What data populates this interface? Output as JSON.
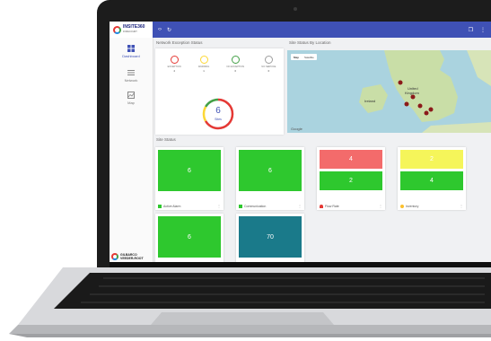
{
  "app": {
    "brand_name": "INSITE360",
    "brand_sub": "FORECOURT",
    "footer_brand_line1": "GILBARCO",
    "footer_brand_line2": "VEEDER-ROOT"
  },
  "sidebar": {
    "items": [
      {
        "label": "Dashboard",
        "icon": "dashboard-icon",
        "active": true
      },
      {
        "label": "Network",
        "icon": "list-icon",
        "active": false
      },
      {
        "label": "Map",
        "icon": "map-icon",
        "active": false
      }
    ]
  },
  "network_exception": {
    "title": "Network Exception Status",
    "items": [
      {
        "label": "EXCEPTION",
        "count": "4",
        "color": "#e53935"
      },
      {
        "label": "WARNING",
        "count": "1",
        "color": "#fdd835"
      },
      {
        "label": "NO EXCEPTION",
        "count": "0",
        "color": "#43a047"
      },
      {
        "label": "NO SERVICE",
        "count": "0",
        "color": "#9e9e9e"
      }
    ],
    "total": "6",
    "total_label": "Sites"
  },
  "location": {
    "title": "Site Status By Location",
    "tabs": [
      "Map",
      "Satellite"
    ],
    "labels": [
      "United",
      "Kingdom",
      "Ireland"
    ],
    "attribution": "Google"
  },
  "site_status": {
    "title": "Site Status",
    "cards": [
      {
        "label": "Active Alarm",
        "tiles": [
          {
            "value": "6",
            "color": "#2ec82e"
          }
        ],
        "icon_color": "#2ec82e"
      },
      {
        "label": "Communication",
        "tiles": [
          {
            "value": "6",
            "color": "#2ec82e"
          }
        ],
        "icon_color": "#2ec82e"
      },
      {
        "label": "Flow Rate",
        "tiles": [
          {
            "value": "4",
            "color": "#f36b6b"
          },
          {
            "value": "2",
            "color": "#2ec82e"
          }
        ],
        "icon_color": "#e53935"
      },
      {
        "label": "Inventory",
        "tiles": [
          {
            "value": "2",
            "color": "#f5f55a"
          },
          {
            "value": "4",
            "color": "#2ec82e"
          }
        ],
        "icon_color": "#fbc02d"
      },
      {
        "label": "",
        "tiles": [
          {
            "value": "6",
            "color": "#2ec82e"
          }
        ],
        "icon_color": "#2ec82e"
      },
      {
        "label": "",
        "tiles": [
          {
            "value": "70",
            "color": "#1a7a8a"
          }
        ],
        "icon_color": "#1a7a8a"
      }
    ]
  }
}
